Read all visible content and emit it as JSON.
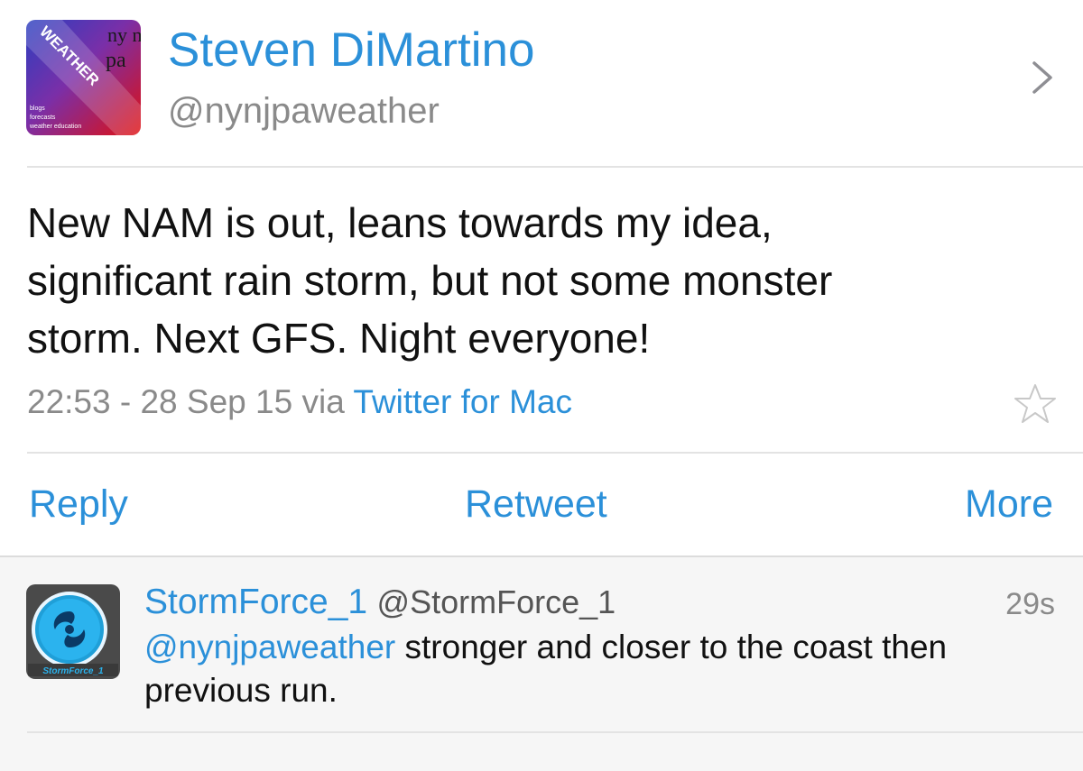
{
  "tweet": {
    "author": {
      "name": "Steven DiMartino",
      "handle": "@nynjpaweather",
      "avatar_icon": "nynjpa-weather-logo",
      "avatar_text": {
        "top": "ny nj",
        "mid": "pa",
        "diagonal": "WEATHER",
        "lines": [
          "blogs",
          "forecasts",
          "weather education"
        ]
      }
    },
    "text": "New NAM is out, leans towards my idea,\nsignificant rain storm, but not some monster\nstorm.  Next GFS.  Night everyone!",
    "time": "22:53",
    "date_separator": " - ",
    "date": "28 Sep 15",
    "via_label": " via ",
    "via_app": "Twitter for Mac",
    "favorite_icon": "star-outline-icon",
    "detail_icon": "chevron-right-icon"
  },
  "actions": {
    "reply": "Reply",
    "retweet": "Retweet",
    "more": "More"
  },
  "reply": {
    "name": "StormForce_1",
    "handle": "@StormForce_1",
    "time": "29s",
    "mention": "@nynjpaweather",
    "text": " stronger and closer to the coast then previous run.",
    "avatar_icon": "hurricane-logo",
    "avatar_label": "StormForce_1"
  },
  "colors": {
    "link_blue": "#2b90d9",
    "meta_gray": "#8a8a8a",
    "reply_bg": "#f6f6f6"
  }
}
